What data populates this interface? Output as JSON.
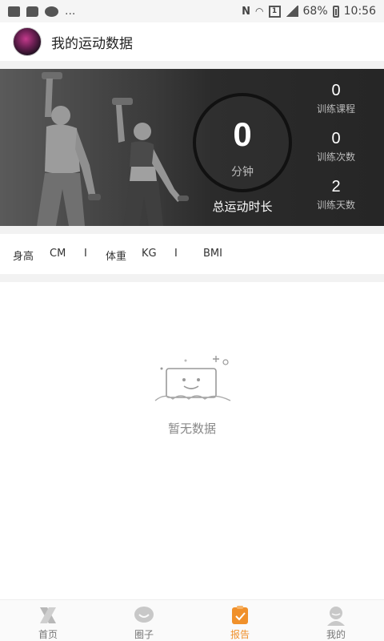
{
  "status_bar": {
    "dots": "...",
    "battery": "68%",
    "time": "10:56",
    "sim_label": "1"
  },
  "header": {
    "title": "我的运动数据"
  },
  "banner": {
    "minutes_value": "0",
    "minutes_unit": "分钟",
    "total_label": "总运动时长",
    "stats": [
      {
        "value": "0",
        "label": "训练课程"
      },
      {
        "value": "0",
        "label": "训练次数"
      },
      {
        "value": "2",
        "label": "训练天数"
      }
    ]
  },
  "metrics": {
    "height_label": "身高",
    "height_unit": "CM",
    "sep": "I",
    "weight_label": "体重",
    "weight_unit": "KG",
    "bmi_label": "BMI"
  },
  "empty_state": {
    "text": "暂无数据"
  },
  "bottom_nav": {
    "items": [
      {
        "label": "首页",
        "icon": "x-logo-icon"
      },
      {
        "label": "圈子",
        "icon": "smile-bubble-icon"
      },
      {
        "label": "报告",
        "icon": "clipboard-check-icon",
        "active": true
      },
      {
        "label": "我的",
        "icon": "profile-icon"
      }
    ],
    "active_color": "#f0902a",
    "inactive_color": "#b0b0b0"
  }
}
